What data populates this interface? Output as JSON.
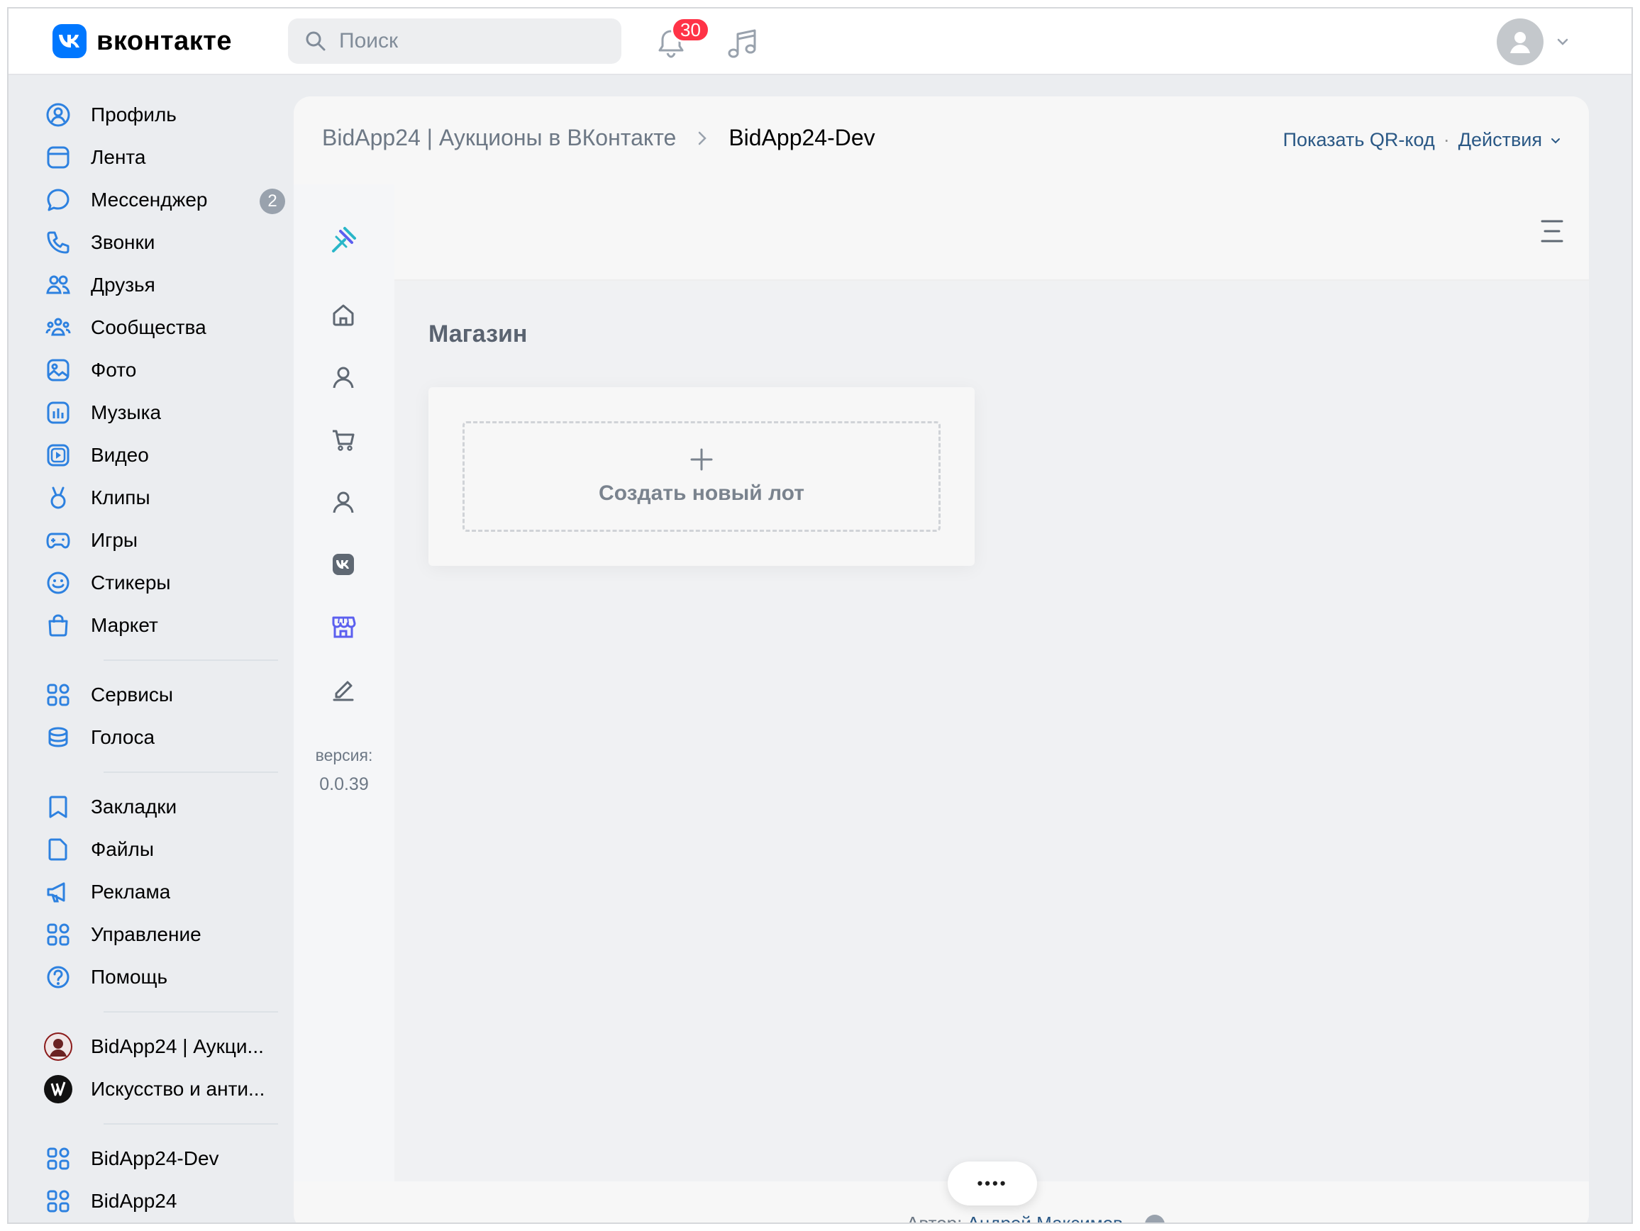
{
  "header": {
    "logo_text": "вконтакте",
    "search_placeholder": "Поиск",
    "notifications_count": "30"
  },
  "sidebar": {
    "items": [
      {
        "label": "Профиль",
        "icon": "profile-icon"
      },
      {
        "label": "Лента",
        "icon": "feed-icon"
      },
      {
        "label": "Мессенджер",
        "icon": "messenger-icon",
        "count": "2"
      },
      {
        "label": "Звонки",
        "icon": "phone-icon"
      },
      {
        "label": "Друзья",
        "icon": "friends-icon"
      },
      {
        "label": "Сообщества",
        "icon": "communities-icon"
      },
      {
        "label": "Фото",
        "icon": "photo-icon"
      },
      {
        "label": "Музыка",
        "icon": "music-icon"
      },
      {
        "label": "Видео",
        "icon": "video-icon"
      },
      {
        "label": "Клипы",
        "icon": "clips-icon"
      },
      {
        "label": "Игры",
        "icon": "games-icon"
      },
      {
        "label": "Стикеры",
        "icon": "stickers-icon"
      },
      {
        "label": "Маркет",
        "icon": "market-icon"
      }
    ],
    "items2": [
      {
        "label": "Сервисы",
        "icon": "services-icon"
      },
      {
        "label": "Голоса",
        "icon": "votes-icon"
      }
    ],
    "items3": [
      {
        "label": "Закладки",
        "icon": "bookmarks-icon"
      },
      {
        "label": "Файлы",
        "icon": "files-icon"
      },
      {
        "label": "Реклама",
        "icon": "ads-icon"
      },
      {
        "label": "Управление",
        "icon": "manage-icon"
      },
      {
        "label": "Помощь",
        "icon": "help-icon"
      }
    ],
    "groups": [
      {
        "label": "BidApp24 | Аукци...",
        "icon": "group-avatar-icon"
      },
      {
        "label": "Искусство и анти...",
        "icon": "group-avatar-icon"
      }
    ],
    "apps": [
      {
        "label": "BidApp24-Dev",
        "icon": "app-icon"
      },
      {
        "label": "BidApp24",
        "icon": "app-icon"
      }
    ]
  },
  "card": {
    "breadcrumb_root": "BidApp24 | Аукционы в ВКонтакте",
    "breadcrumb_current": "BidApp24-Dev",
    "action_qr": "Показать QR-код",
    "action_sep": "·",
    "action_actions": "Действия"
  },
  "app": {
    "version_label": "версия:",
    "version_value": "0.0.39",
    "section_title": "Магазин",
    "create_lot_label": "Создать новый лот",
    "more_label": "••••",
    "author_label": "Автор:",
    "author_name": "Андрей Максимов"
  },
  "colors": {
    "accent": "#0077ff",
    "link": "#2a5885",
    "badge": "#ff3347",
    "store_active": "#5b5fef"
  }
}
